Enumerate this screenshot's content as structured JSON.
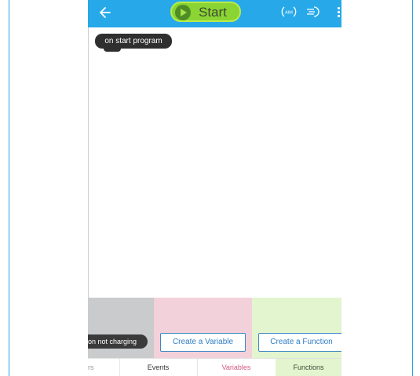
{
  "toolbar": {
    "start_label": "Start",
    "aim_label": "AIM"
  },
  "canvas": {
    "start_block_label": "on start program"
  },
  "palette": {
    "charge_block_label": "on not charging",
    "create_variable_label": "Create a Variable",
    "create_function_label": "Create a Function"
  },
  "tabs": [
    {
      "label": "rs"
    },
    {
      "label": "Events"
    },
    {
      "label": "Variables"
    },
    {
      "label": "Functions"
    }
  ],
  "colors": {
    "topbar": "#27a9e9",
    "start_button": "#8ad433",
    "variables_palette": "#f3d1db",
    "functions_palette": "#e2f5cf",
    "sensors_palette": "#cacbcd",
    "frame_border": "#2aa3df"
  },
  "icons": {
    "back": "back-arrow-icon",
    "play": "play-icon",
    "aim": "aim-icon",
    "speed": "speed-icon",
    "more": "more-vertical-icon"
  }
}
